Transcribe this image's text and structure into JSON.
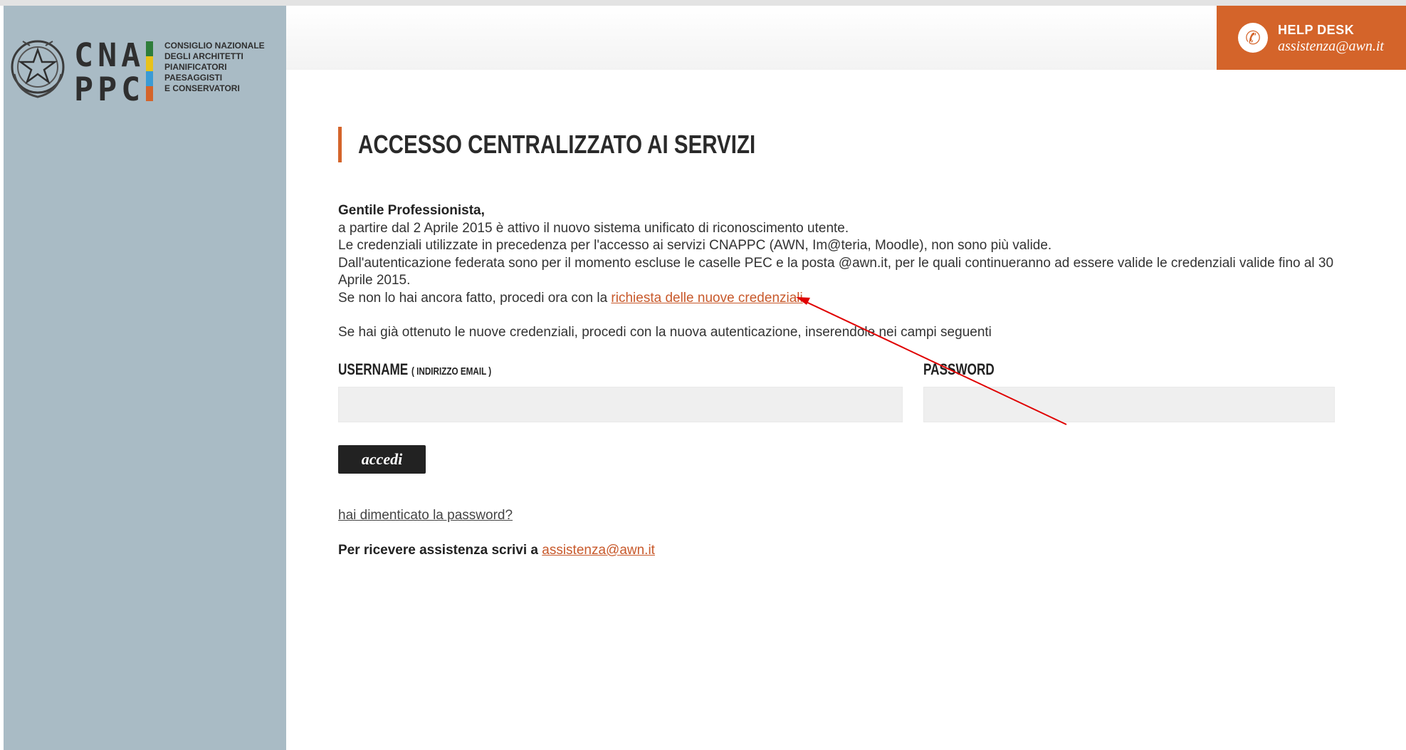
{
  "logo": {
    "letters_line1": "CNA",
    "letters_line2": "PPC",
    "name_lines": [
      "CONSIGLIO NAZIONALE",
      "DEGLI ARCHITETTI",
      "PIANIFICATORI",
      "PAESAGGISTI",
      "E CONSERVATORI"
    ],
    "bar_colors": [
      "#2e7d3a",
      "#e8c21a",
      "#3a9bd5",
      "#d4642a"
    ]
  },
  "helpdesk": {
    "title": "HELP DESK",
    "email": "assistenza@awn.it",
    "icon": "phone-icon",
    "color": "#d4642a"
  },
  "page": {
    "title": "ACCESSO CENTRALIZZATO AI SERVIZI"
  },
  "intro": {
    "greeting": "Gentile Professionista,",
    "line1": "a partire dal 2 Aprile 2015 è attivo il nuovo sistema unificato di riconoscimento utente.",
    "line2": "Le credenziali utilizzate in precedenza per l'accesso ai servizi CNAPPC (AWN, Im@teria, Moodle), non sono più valide.",
    "line3": "Dall'autenticazione federata sono per il momento escluse le caselle PEC e la posta @awn.it, per le quali continueranno ad essere valide le credenziali valide fino al 30 Aprile 2015.",
    "line4_prefix": "Se non lo hai ancora fatto, procedi ora con la ",
    "line4_link": "richiesta delle nuove credenziali",
    "line5": "Se hai già ottenuto le nuove credenziali, procedi con la nuova autenticazione, inserendole nei campi seguenti"
  },
  "form": {
    "username_label": "USERNAME",
    "username_hint": "( INDIRIZZO EMAIL )",
    "username_value": "",
    "password_label": "PASSWORD",
    "password_value": "",
    "submit_label": "accedi"
  },
  "footer": {
    "forgot_link": "hai dimenticato la password?",
    "assist_prefix": "Per ricevere assistenza scrivi a ",
    "assist_email": "assistenza@awn.it"
  },
  "annotation": {
    "arrow_color": "#e00000"
  }
}
